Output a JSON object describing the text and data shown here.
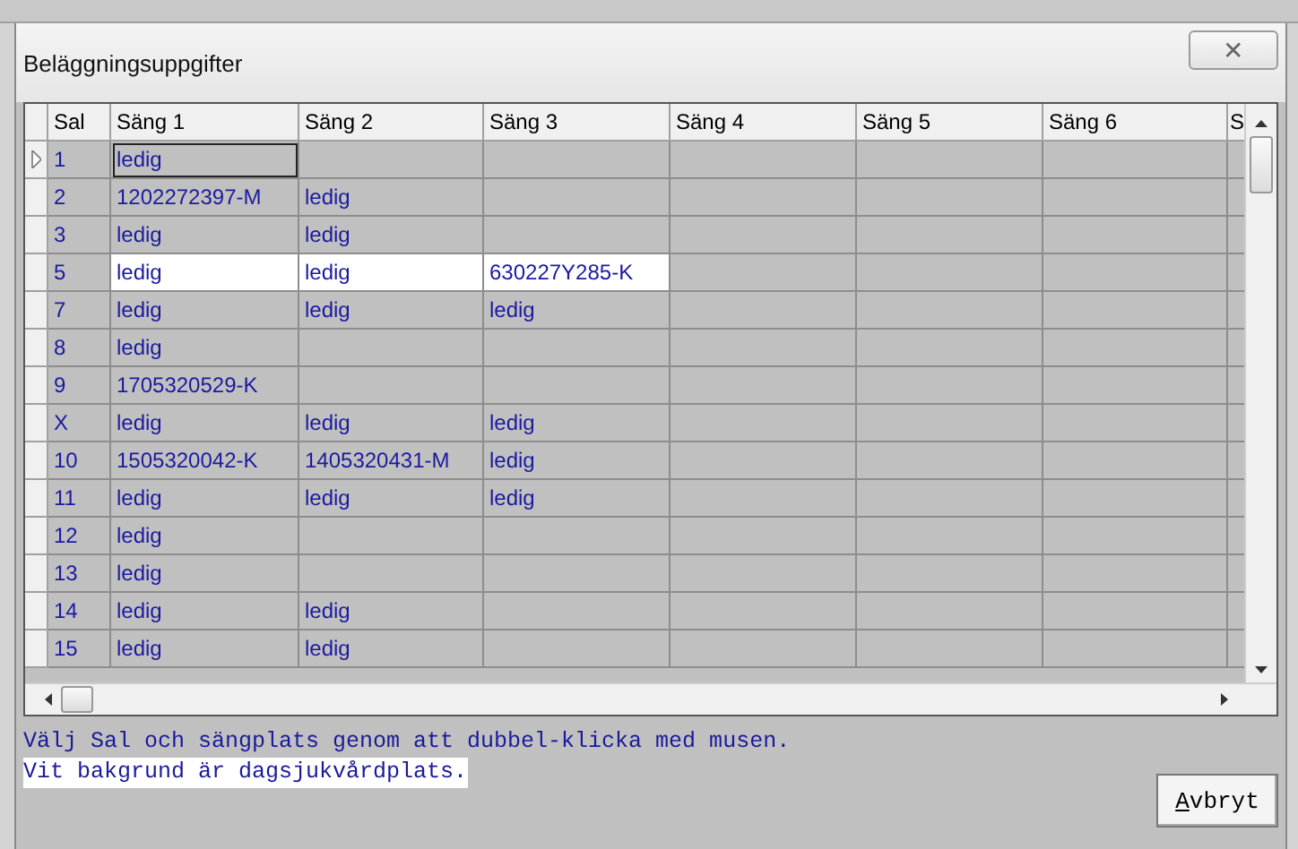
{
  "window": {
    "title": "Beläggningsuppgifter",
    "close": "✕"
  },
  "table": {
    "columns": [
      "Sal",
      "Säng 1",
      "Säng 2",
      "Säng 3",
      "Säng 4",
      "Säng 5",
      "Säng 6",
      "S"
    ],
    "rows": [
      {
        "selected": true,
        "white": false,
        "cells": [
          "1",
          "ledig"
        ]
      },
      {
        "selected": false,
        "white": false,
        "cells": [
          "2",
          "1202272397-M",
          "ledig"
        ]
      },
      {
        "selected": false,
        "white": false,
        "cells": [
          "3",
          "ledig",
          "ledig"
        ]
      },
      {
        "selected": false,
        "white": true,
        "cells": [
          "5",
          "ledig",
          "ledig",
          "630227Y285-K"
        ]
      },
      {
        "selected": false,
        "white": false,
        "cells": [
          "7",
          "ledig",
          "ledig",
          "ledig"
        ]
      },
      {
        "selected": false,
        "white": false,
        "cells": [
          "8",
          "ledig"
        ]
      },
      {
        "selected": false,
        "white": false,
        "cells": [
          "9",
          "1705320529-K"
        ]
      },
      {
        "selected": false,
        "white": false,
        "cells": [
          "X",
          "ledig",
          "ledig",
          "ledig"
        ]
      },
      {
        "selected": false,
        "white": false,
        "cells": [
          "10",
          "1505320042-K",
          "1405320431-M",
          "ledig"
        ]
      },
      {
        "selected": false,
        "white": false,
        "cells": [
          "11",
          "ledig",
          "ledig",
          "ledig"
        ]
      },
      {
        "selected": false,
        "white": false,
        "cells": [
          "12",
          "ledig"
        ]
      },
      {
        "selected": false,
        "white": false,
        "cells": [
          "13",
          "ledig"
        ]
      },
      {
        "selected": false,
        "white": false,
        "cells": [
          "14",
          "ledig",
          "ledig"
        ]
      },
      {
        "selected": false,
        "white": false,
        "cells": [
          "15",
          "ledig",
          "ledig"
        ]
      }
    ]
  },
  "hints": [
    {
      "text": "Välj Sal och sängplats genom att dubbel-klicka med musen.",
      "white": false
    },
    {
      "text": "Vit bakgrund är dagsjukvårdplats.",
      "white": true
    }
  ],
  "buttons": [
    {
      "label": "Avbryt",
      "underline_first": true
    }
  ]
}
